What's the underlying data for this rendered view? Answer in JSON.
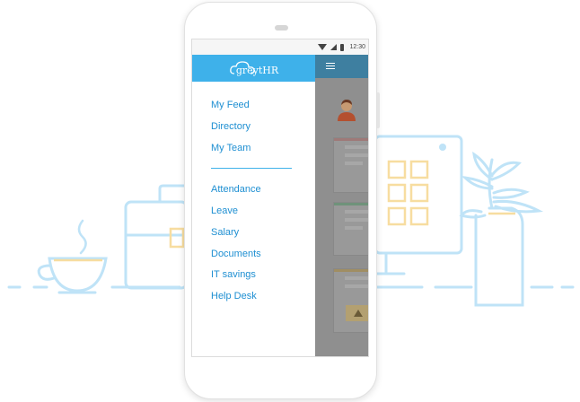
{
  "status_bar": {
    "time": "12:30"
  },
  "app": {
    "logo_text": "greytHR"
  },
  "drawer": {
    "primary_items": [
      {
        "label": "My Feed"
      },
      {
        "label": "Directory"
      },
      {
        "label": "My Team"
      }
    ],
    "secondary_items": [
      {
        "label": "Attendance"
      },
      {
        "label": "Leave"
      },
      {
        "label": "Salary"
      },
      {
        "label": "Documents"
      },
      {
        "label": "IT savings"
      },
      {
        "label": "Help Desk"
      }
    ]
  },
  "colors": {
    "brand_blue": "#3eb1ea",
    "link_blue": "#1e8fd2",
    "illustration_blue": "#bfe3f7",
    "illustration_yellow": "#f7dda0"
  },
  "icons": [
    "wifi-icon",
    "signal-icon",
    "battery-icon",
    "menu-icon",
    "cloud-logo-icon",
    "avatar-icon",
    "warning-icon"
  ]
}
